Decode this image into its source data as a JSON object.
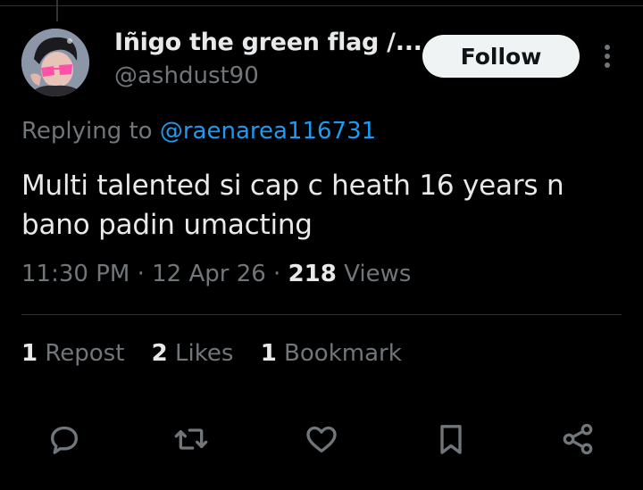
{
  "user": {
    "display_name": "Iñigo the green flag /...",
    "handle": "@ashdust90"
  },
  "follow_label": "Follow",
  "replying": {
    "prefix": "Replying to ",
    "mention": "@raenarea116731"
  },
  "tweet": {
    "text": "Multi talented si cap c heath 16 years n bano padin umacting",
    "time": "11:30 PM",
    "sep1": " · ",
    "date": "12 Apr 26",
    "sep2": " · ",
    "views_count": "218",
    "views_label": " Views"
  },
  "stats": {
    "reposts_count": "1",
    "reposts_label": " Repost",
    "likes_count": "2",
    "likes_label": " Likes",
    "bookmarks_count": "1",
    "bookmarks_label": " Bookmark"
  },
  "actions": [
    {
      "icon": "reply-icon"
    },
    {
      "icon": "repost-icon"
    },
    {
      "icon": "like-icon"
    },
    {
      "icon": "bookmark-icon"
    },
    {
      "icon": "share-icon"
    }
  ],
  "colors": {
    "background": "#000000",
    "text": "#e7e9ea",
    "muted": "#71767b",
    "link": "#1d9bf0",
    "follow_bg": "#eff3f4"
  }
}
